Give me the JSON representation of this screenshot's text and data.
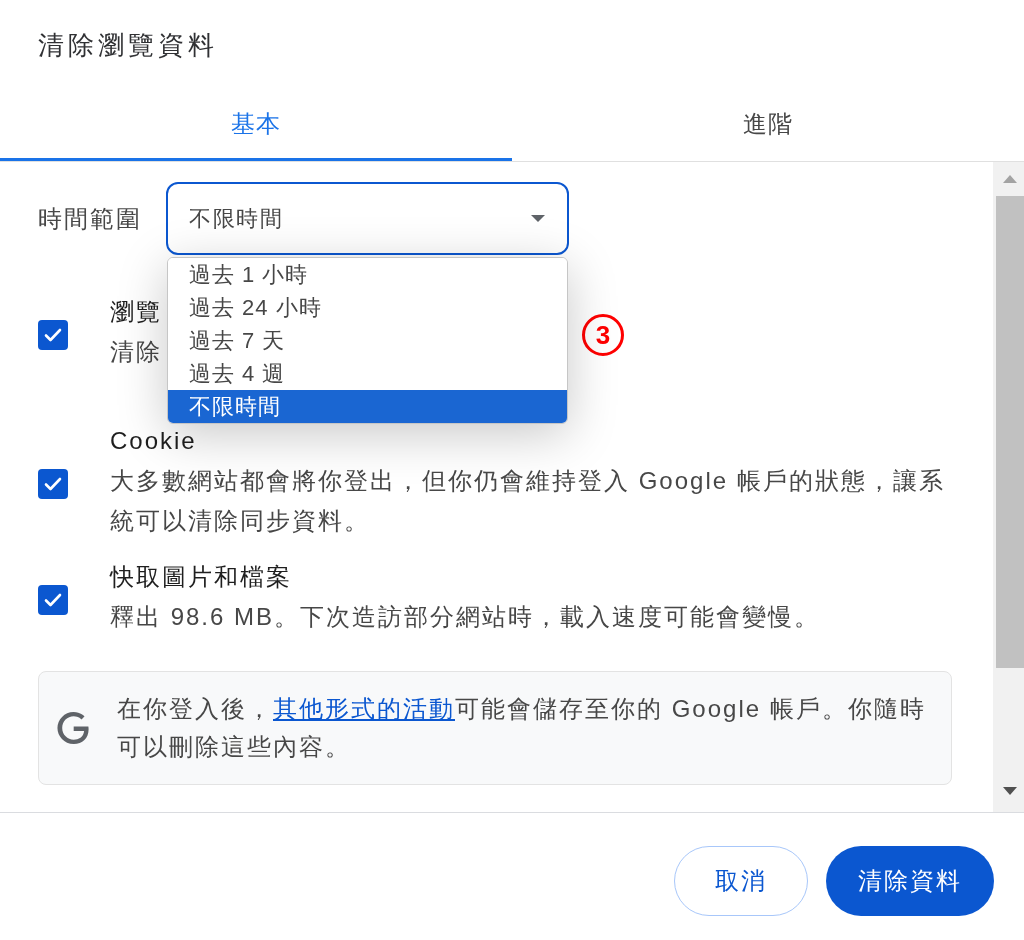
{
  "dialog": {
    "title": "清除瀏覽資料"
  },
  "tabs": [
    {
      "label": "基本",
      "selected": true
    },
    {
      "label": "進階",
      "selected": false
    }
  ],
  "time_range": {
    "label": "時間範圍",
    "value": "不限時間",
    "expanded": true,
    "options": [
      {
        "label": "過去 1 小時",
        "selected": false
      },
      {
        "label": "過去 24 小時",
        "selected": false
      },
      {
        "label": "過去 7 天",
        "selected": false
      },
      {
        "label": "過去 4 週",
        "selected": false
      },
      {
        "label": "不限時間",
        "selected": true
      }
    ]
  },
  "items": [
    {
      "title": "瀏覽",
      "description": "清除",
      "checked": true
    },
    {
      "title": "Cookie",
      "description": "大多數網站都會將你登出，但你仍會維持登入 Google 帳戶的狀態，讓系統可以清除同步資料。",
      "checked": true
    },
    {
      "title": "快取圖片和檔案",
      "description": "釋出 98.6 MB。下次造訪部分網站時，載入速度可能會變慢。",
      "checked": true
    }
  ],
  "info": {
    "text_before": "在你登入後，",
    "link": "其他形式的活動",
    "text_after": "可能會儲存至你的 Google 帳戶。你隨時可以刪除這些內容。"
  },
  "step_marker": "3",
  "buttons": [
    {
      "label": "取消",
      "kind": "secondary"
    },
    {
      "label": "清除資料",
      "kind": "primary"
    }
  ]
}
